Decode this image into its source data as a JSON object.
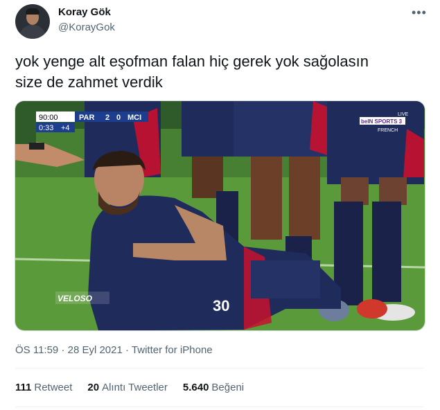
{
  "author": {
    "name": "Koray Gök",
    "handle": "@KorayGok"
  },
  "tweet": {
    "line1": "yok yenge alt eşofman falan hiç gerek yok sağolasın",
    "line2": "size de zahmet verdik"
  },
  "scoreboard": {
    "time": "90:00",
    "home": "PAR",
    "home_score": "2",
    "away_score": "0",
    "away": "MCI",
    "added_time": "0:33",
    "plus": "+4"
  },
  "broadcaster": {
    "live": "LIVE",
    "name": "beIN SPORTS 3",
    "lang": "FRENCH"
  },
  "watermark": "VELOSO",
  "jersey_number": "30",
  "meta": {
    "time": "ÖS 11:59",
    "date": "28 Eyl 2021",
    "source": "Twitter for iPhone"
  },
  "stats": {
    "retweets_count": "111",
    "retweets_label": "Retweet",
    "quotes_count": "20",
    "quotes_label": "Alıntı Tweetler",
    "likes_count": "5.640",
    "likes_label": "Beğeni"
  },
  "colors": {
    "accent": "#1d9bf0",
    "text": "#0f1419",
    "muted": "#536471",
    "kit_navy": "#1f2b5a",
    "kit_red": "#c8102e",
    "grass": "#5f9a3c"
  }
}
